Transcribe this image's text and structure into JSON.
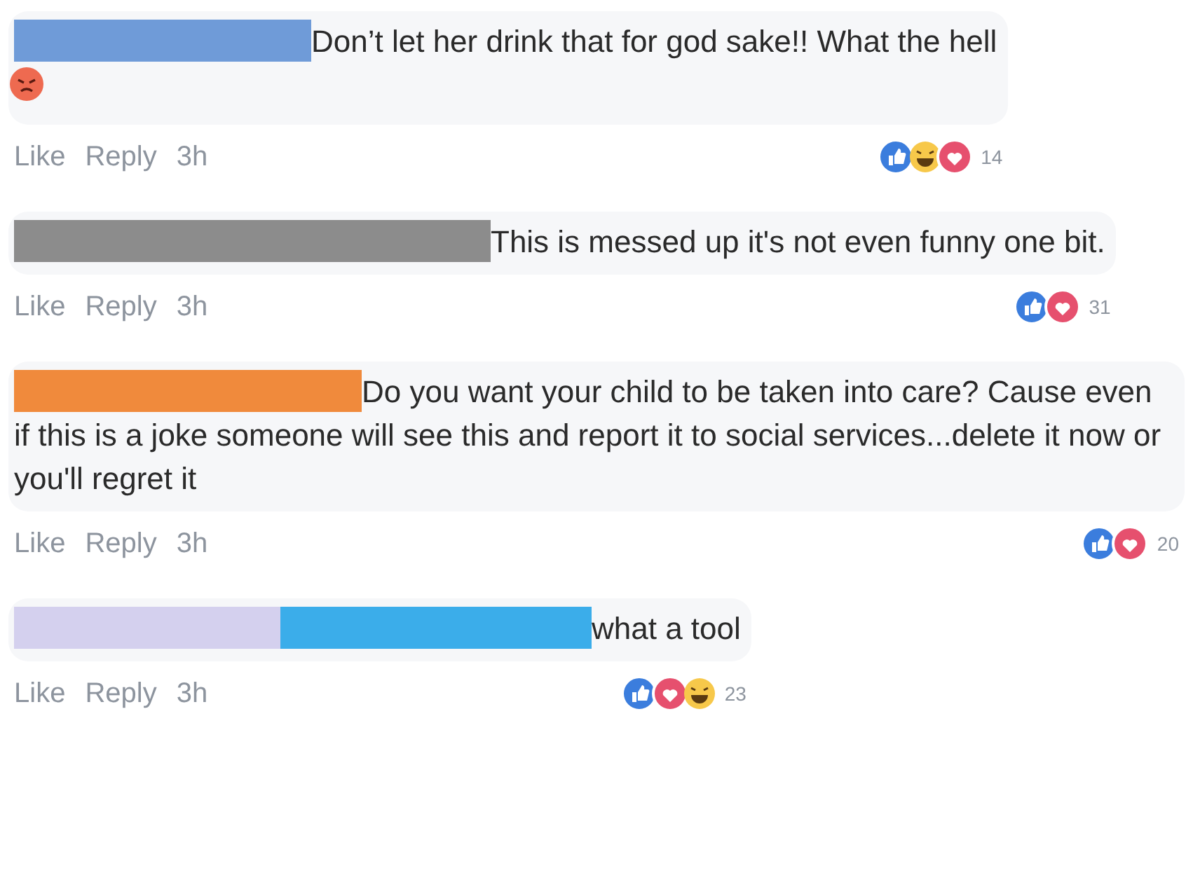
{
  "comments": [
    {
      "redactions": [
        {
          "color": "#6f9bd8"
        }
      ],
      "text": "Don’t let her drink that for god sake!! What the hell",
      "emoji": {
        "kind": "angry"
      },
      "actions": [
        "Like",
        "Reply",
        "3h"
      ],
      "reactions": [
        {
          "kind": "like"
        },
        {
          "kind": "haha"
        },
        {
          "kind": "love"
        }
      ],
      "count": "14"
    },
    {
      "redactions": [
        {
          "color": "#8c8c8c"
        }
      ],
      "text": "This is messed up it's not even funny one bit.",
      "actions": [
        "Like",
        "Reply",
        "3h"
      ],
      "reactions": [
        {
          "kind": "like"
        },
        {
          "kind": "love"
        }
      ],
      "count": "31"
    },
    {
      "redactions": [
        {
          "color": "#f08a3c"
        }
      ],
      "text": "Do you want your child to be taken into care? Cause even if this is a joke someone will see this and report it to social services...delete it now or you'll regret it",
      "actions": [
        "Like",
        "Reply",
        "3h"
      ],
      "reactions": [
        {
          "kind": "like"
        },
        {
          "kind": "love"
        }
      ],
      "count": "20"
    },
    {
      "redactions": [
        {
          "color": "#d4d0ee"
        },
        {
          "color": "#3badea"
        }
      ],
      "text": "what a tool",
      "actions": [
        "Like",
        "Reply",
        "3h"
      ],
      "reactions": [
        {
          "kind": "like"
        },
        {
          "kind": "love"
        },
        {
          "kind": "haha"
        }
      ],
      "count": "23"
    }
  ]
}
